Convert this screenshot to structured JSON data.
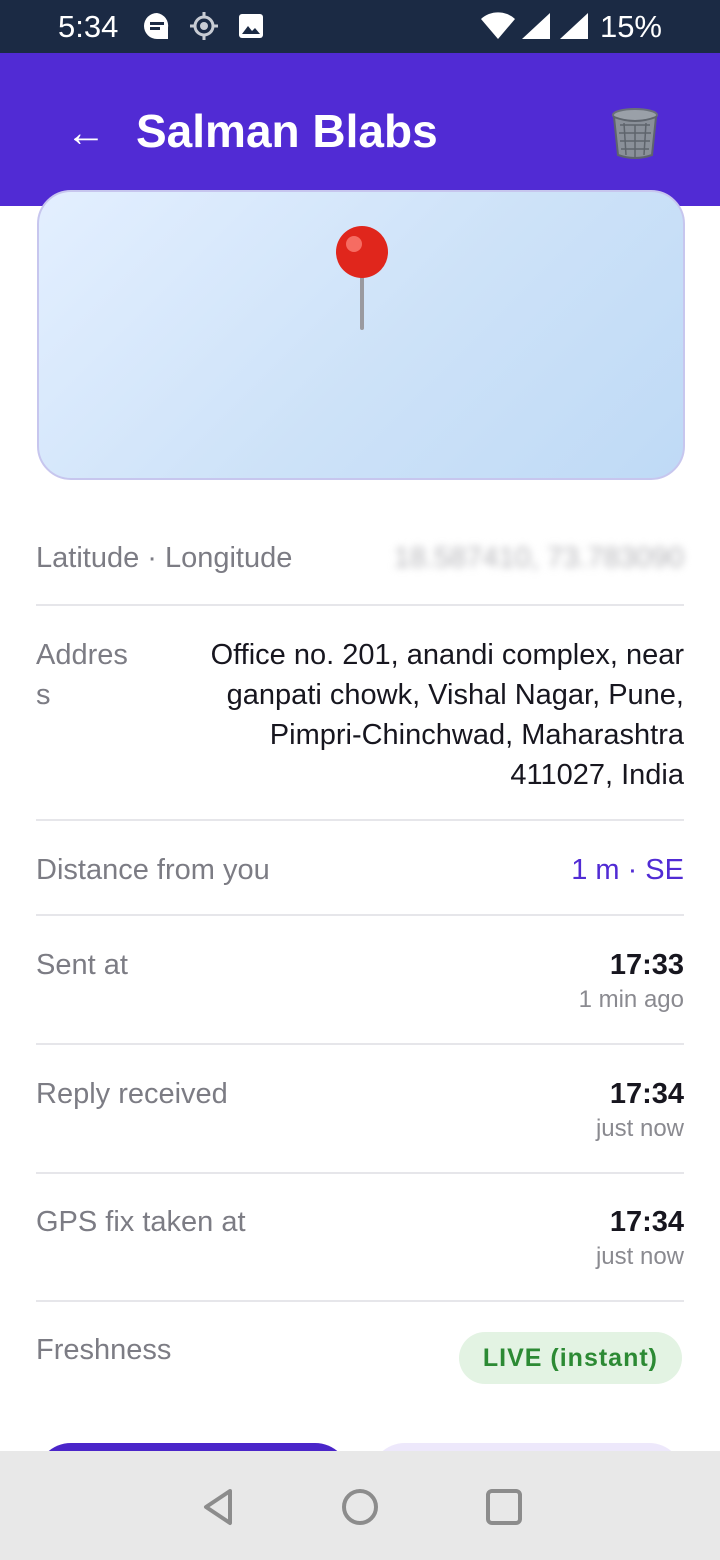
{
  "status_bar": {
    "time": "5:34",
    "battery": "15%",
    "icons": [
      "message-icon",
      "location-crosshair-icon",
      "image-icon",
      "wifi-icon",
      "signal-icon",
      "signal-icon"
    ]
  },
  "app_bar": {
    "title": "Salman Blabs",
    "back_icon": "←",
    "delete_icon": "trash-icon",
    "background": "#512bd4"
  },
  "map": {
    "pin_icon": "red-pin-icon"
  },
  "details": {
    "latlng": {
      "label": "Latitude · Longitude",
      "value": "18.587410, 73.783090"
    },
    "address": {
      "label_line1": "Addres",
      "label_line2": "s",
      "lines": [
        "Office no. 201, anandi complex, near",
        "ganpati chowk, Vishal Nagar, Pune,",
        "Pimpri-Chinchwad, Maharashtra",
        "411027, India"
      ]
    },
    "distance": {
      "label": "Distance from you",
      "value": "1 m · SE"
    },
    "sent": {
      "label": "Sent at",
      "time": "17:33",
      "ago": "1 min ago"
    },
    "reply": {
      "label": "Reply received",
      "time": "17:34",
      "ago": "just now"
    },
    "gps": {
      "label": "GPS fix taken at",
      "time": "17:34",
      "ago": "just now"
    },
    "freshness": {
      "label": "Freshness",
      "badge": "LIVE (instant)"
    }
  },
  "colors": {
    "accent": "#512bd4",
    "status_bar": "#1b2a44",
    "badge_bg": "#e3f3e3",
    "badge_text": "#2c8a34"
  }
}
